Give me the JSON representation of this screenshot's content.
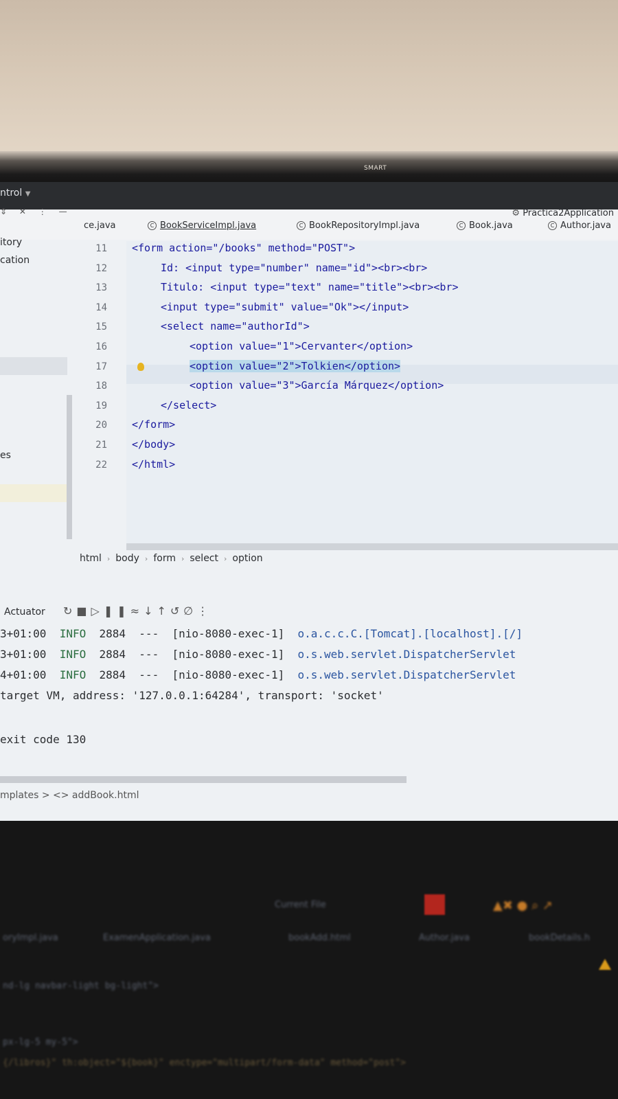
{
  "monitor": {
    "brand": "SMART"
  },
  "ide": {
    "menu_label": "ntrol",
    "run_config": "Practica2Application",
    "tabs": [
      {
        "label": "ce.java"
      },
      {
        "label": "BookServiceImpl.java"
      },
      {
        "label": "BookRepositoryImpl.java"
      },
      {
        "label": "Book.java"
      },
      {
        "label": "Author.java"
      }
    ],
    "project": {
      "items": [
        "itory",
        "cation",
        "es"
      ]
    },
    "editor": {
      "lines": [
        {
          "n": "11",
          "text": "<form action=\"/books\" method=\"POST\">"
        },
        {
          "n": "12",
          "text": "Id: <input type=\"number\" name=\"id\"><br><br>"
        },
        {
          "n": "13",
          "text": "Titulo: <input type=\"text\" name=\"title\"><br><br>"
        },
        {
          "n": "14",
          "text": "<input type=\"submit\" value=\"Ok\"></input>"
        },
        {
          "n": "15",
          "text": "<select name=\"authorId\">"
        },
        {
          "n": "16",
          "text": "<option value=\"1\">Cervanter</option>"
        },
        {
          "n": "17",
          "text": "<option value=\"2\">Tolkien</option>"
        },
        {
          "n": "18",
          "text": "<option value=\"3\">García Márquez</option>"
        },
        {
          "n": "19",
          "text": "</select>"
        },
        {
          "n": "20",
          "text": "</form>"
        },
        {
          "n": "21",
          "text": "</body>"
        },
        {
          "n": "22",
          "text": "</html>"
        }
      ]
    },
    "breadcrumb": [
      "html",
      "body",
      "form",
      "select",
      "option"
    ],
    "console": {
      "title": "Actuator",
      "logs": [
        {
          "ts": "3+01:00",
          "level": "INFO",
          "pid": "2884",
          "sep": "---",
          "thread": "[nio-8080-exec-1]",
          "logger": "o.a.c.c.C.[Tomcat].[localhost].[/]"
        },
        {
          "ts": "3+01:00",
          "level": "INFO",
          "pid": "2884",
          "sep": "---",
          "thread": "[nio-8080-exec-1]",
          "logger": "o.s.web.servlet.DispatcherServlet"
        },
        {
          "ts": "4+01:00",
          "level": "INFO",
          "pid": "2884",
          "sep": "---",
          "thread": "[nio-8080-exec-1]",
          "logger": "o.s.web.servlet.DispatcherServlet"
        }
      ],
      "vm_line": "target VM, address: '127.0.0.1:64284', transport: 'socket'",
      "exit_line": "exit code 130"
    },
    "footer_path": "mplates > <> addBook.html"
  },
  "laptop": {
    "toolbar_label": "Current File",
    "tabs": [
      "oryImpl.java",
      "ExamenApplication.java",
      "bookAdd.html",
      "Author.java",
      "bookDetails.h"
    ],
    "code_lines": [
      "nd-lg navbar-light bg-light\">",
      "px-lg-5 my-5\">",
      "{/libros}\" th:object=\"${book}\" enctype=\"multipart/form-data\" method=\"post\">"
    ]
  }
}
